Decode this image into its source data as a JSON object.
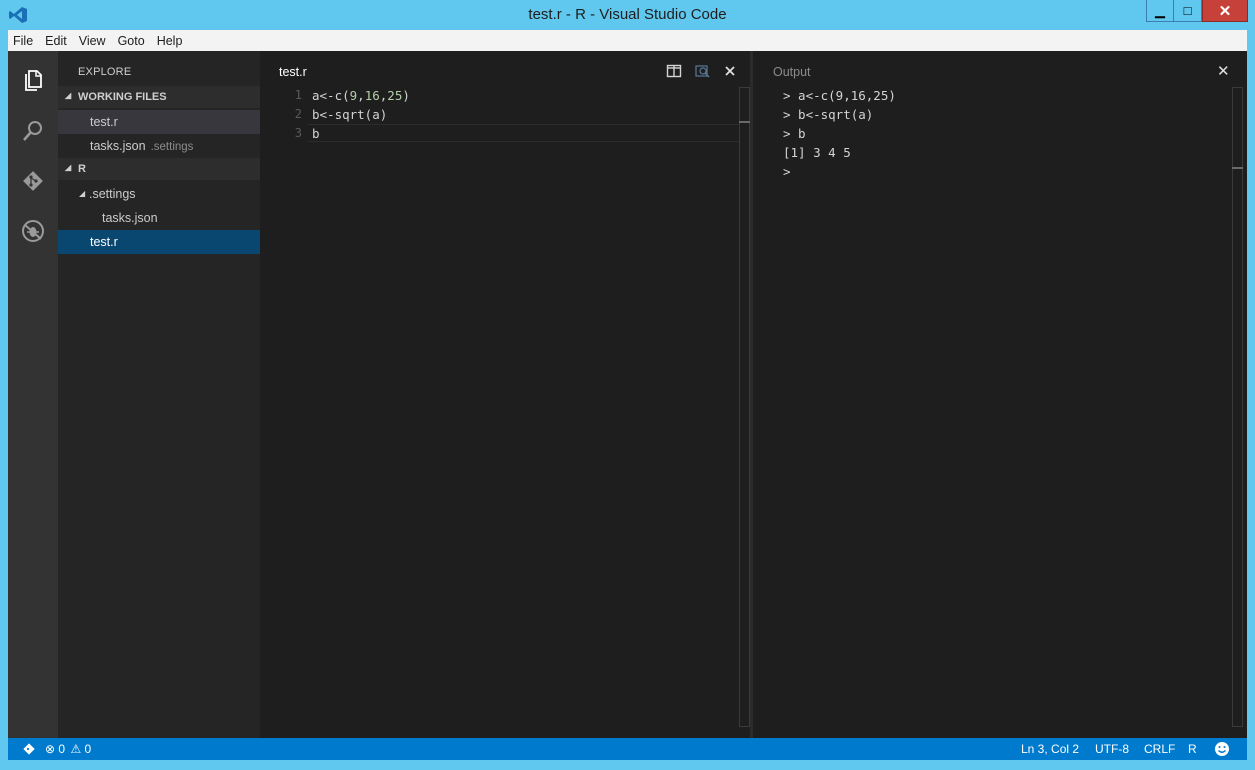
{
  "window": {
    "title": "test.r - R - Visual Studio Code",
    "controls": {
      "minimize": "▁",
      "maximize": "□",
      "close": "✕"
    }
  },
  "menu": [
    "File",
    "Edit",
    "View",
    "Goto",
    "Help"
  ],
  "activity_bar": {
    "icons": [
      "files-icon",
      "search-icon",
      "git-icon",
      "debug-icon"
    ]
  },
  "sidebar": {
    "header": "EXPLORE",
    "working_files": {
      "title": "WORKING FILES",
      "items": [
        {
          "name": "test.r",
          "hint": ""
        },
        {
          "name": "tasks.json",
          "hint": ".settings"
        }
      ]
    },
    "folder": {
      "title": "R",
      "children": [
        {
          "name": ".settings",
          "children": [
            "tasks.json"
          ]
        },
        {
          "name": "test.r"
        }
      ]
    }
  },
  "editor": {
    "tab_title": "test.r",
    "lines": [
      {
        "n": "1",
        "pre": "a<-c(",
        "a": "9",
        "s1": ",",
        "b": "16",
        "s2": ",",
        "c": "25",
        "post": ")"
      },
      {
        "n": "2",
        "text": "b<-sqrt(a)"
      },
      {
        "n": "3",
        "text": "b"
      }
    ]
  },
  "output": {
    "title": "Output",
    "lines": [
      "> a<-c(9,16,25)",
      "> b<-sqrt(a)",
      "> b",
      "[1] 3 4 5",
      ">"
    ]
  },
  "status": {
    "errors": "0",
    "warnings": "0",
    "position": "Ln 3, Col 2",
    "encoding": "UTF-8",
    "eol": "CRLF",
    "language": "R"
  },
  "colors": {
    "titlebar": "#60c8ee",
    "statusbar": "#007acc",
    "selection": "#094771"
  }
}
